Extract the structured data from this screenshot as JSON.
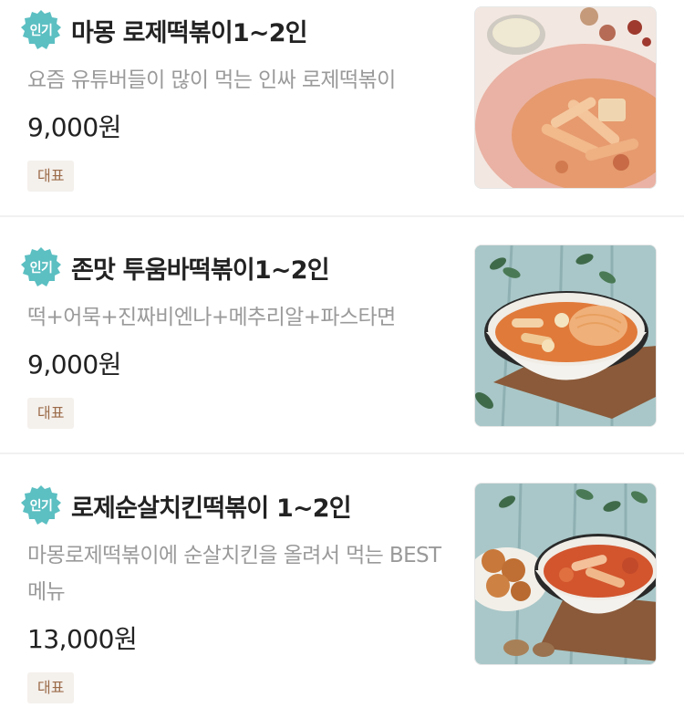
{
  "badge_label": "인기",
  "items": [
    {
      "name": "마몽 로제떡볶이1~2인",
      "description": "요즘 유튜버들이 많이 먹는 인싸 로제떡볶이",
      "price": "9,000원",
      "tag": "대표"
    },
    {
      "name": "존맛 투움바떡볶이1~2인",
      "description": "떡+어묵+진짜비엔나+메추리알+파스타면",
      "price": "9,000원",
      "tag": "대표"
    },
    {
      "name": "로제순살치킨떡볶이 1~2인",
      "description": "마몽로제떡볶이에 순살치킨을 올려서 먹는 BEST 메뉴",
      "price": "13,000원",
      "tag": "대표"
    }
  ],
  "colors": {
    "badge": "#5cbfc2",
    "tag_bg": "#f4f0ec",
    "tag_text": "#9b6b49",
    "description": "#9a9a9a"
  }
}
